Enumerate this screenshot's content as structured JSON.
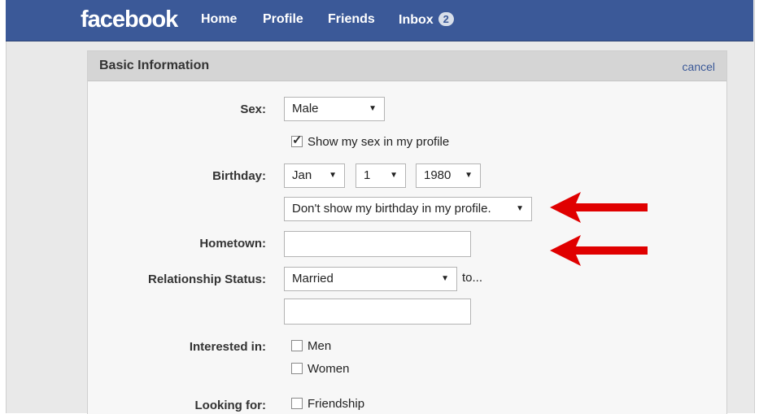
{
  "nav": {
    "logo": "facebook",
    "home": "Home",
    "profile": "Profile",
    "friends": "Friends",
    "inbox": "Inbox",
    "inbox_count": "2"
  },
  "panel": {
    "title": "Basic Information",
    "cancel": "cancel"
  },
  "form": {
    "sex_label": "Sex:",
    "sex_value": "Male",
    "show_sex_label": "Show my sex in my profile",
    "show_sex_checked": true,
    "birthday_label": "Birthday:",
    "birth_month": "Jan",
    "birth_day": "1",
    "birth_year": "1980",
    "birthday_visibility": "Don't show my birthday in my profile.",
    "hometown_label": "Hometown:",
    "hometown_value": "",
    "relationship_label": "Relationship Status:",
    "relationship_value": "Married",
    "to_label": "to...",
    "partner_value": "",
    "interested_label": "Interested in:",
    "interested_men": "Men",
    "interested_women": "Women",
    "looking_label": "Looking for:",
    "looking_friendship": "Friendship"
  },
  "colors": {
    "brand": "#3b5998",
    "arrow": "#e00000"
  }
}
